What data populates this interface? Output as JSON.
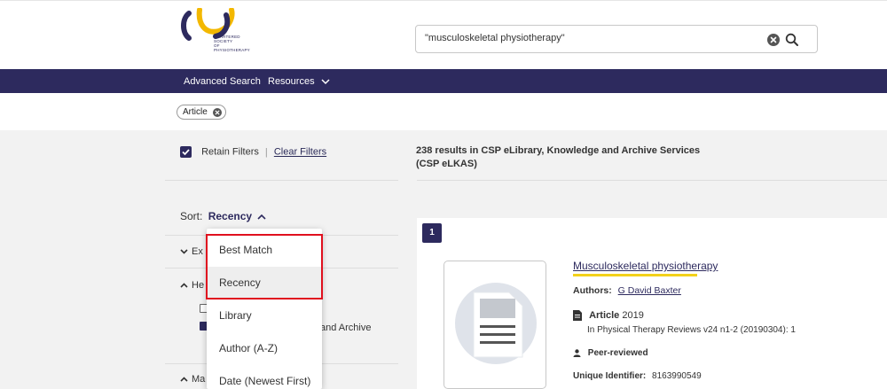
{
  "header": {
    "logo_lines": [
      "CHARTERED",
      "SOCIETY",
      "OF",
      "PHYSIOTHERAPY"
    ],
    "search": {
      "value": "\"musculoskeletal physiotherapy\""
    }
  },
  "nav": {
    "advanced_search": "Advanced Search",
    "resources": "Resources"
  },
  "active_filter": {
    "label": "Article"
  },
  "sidebar": {
    "retain_filters": "Retain Filters",
    "separator": "|",
    "clear_filters": "Clear Filters",
    "sort_label": "Sort:",
    "sort_value": "Recency",
    "facets": [
      {
        "label": "Ex",
        "state": "collapsed"
      },
      {
        "label": "He",
        "state": "expanded"
      },
      {
        "label": "Ma",
        "state": "expanded"
      }
    ],
    "and_archive": "and Archive"
  },
  "sort_dropdown": {
    "options": [
      "Best Match",
      "Recency",
      "Library",
      "Author (A-Z)",
      "Date (Newest First)"
    ],
    "hovered": "Recency"
  },
  "results": {
    "count_text": "238 results in CSP eLibrary, Knowledge and Archive Services (CSP eLKAS)",
    "items": [
      {
        "index": "1",
        "title": "Musculoskeletal physiotherapy",
        "authors_label": "Authors:",
        "authors": "G David Baxter",
        "type": "Article",
        "year": "2019",
        "source": "In Physical Therapy Reviews v24 n1-2 (20190304): 1",
        "peer_reviewed": "Peer-reviewed",
        "uid_label": "Unique Identifier:",
        "uid": "8163990549"
      }
    ]
  },
  "colors": {
    "brand": "#2d2a5e",
    "accent_yellow": "#f3d11a",
    "highlight_red": "#e0101e"
  }
}
